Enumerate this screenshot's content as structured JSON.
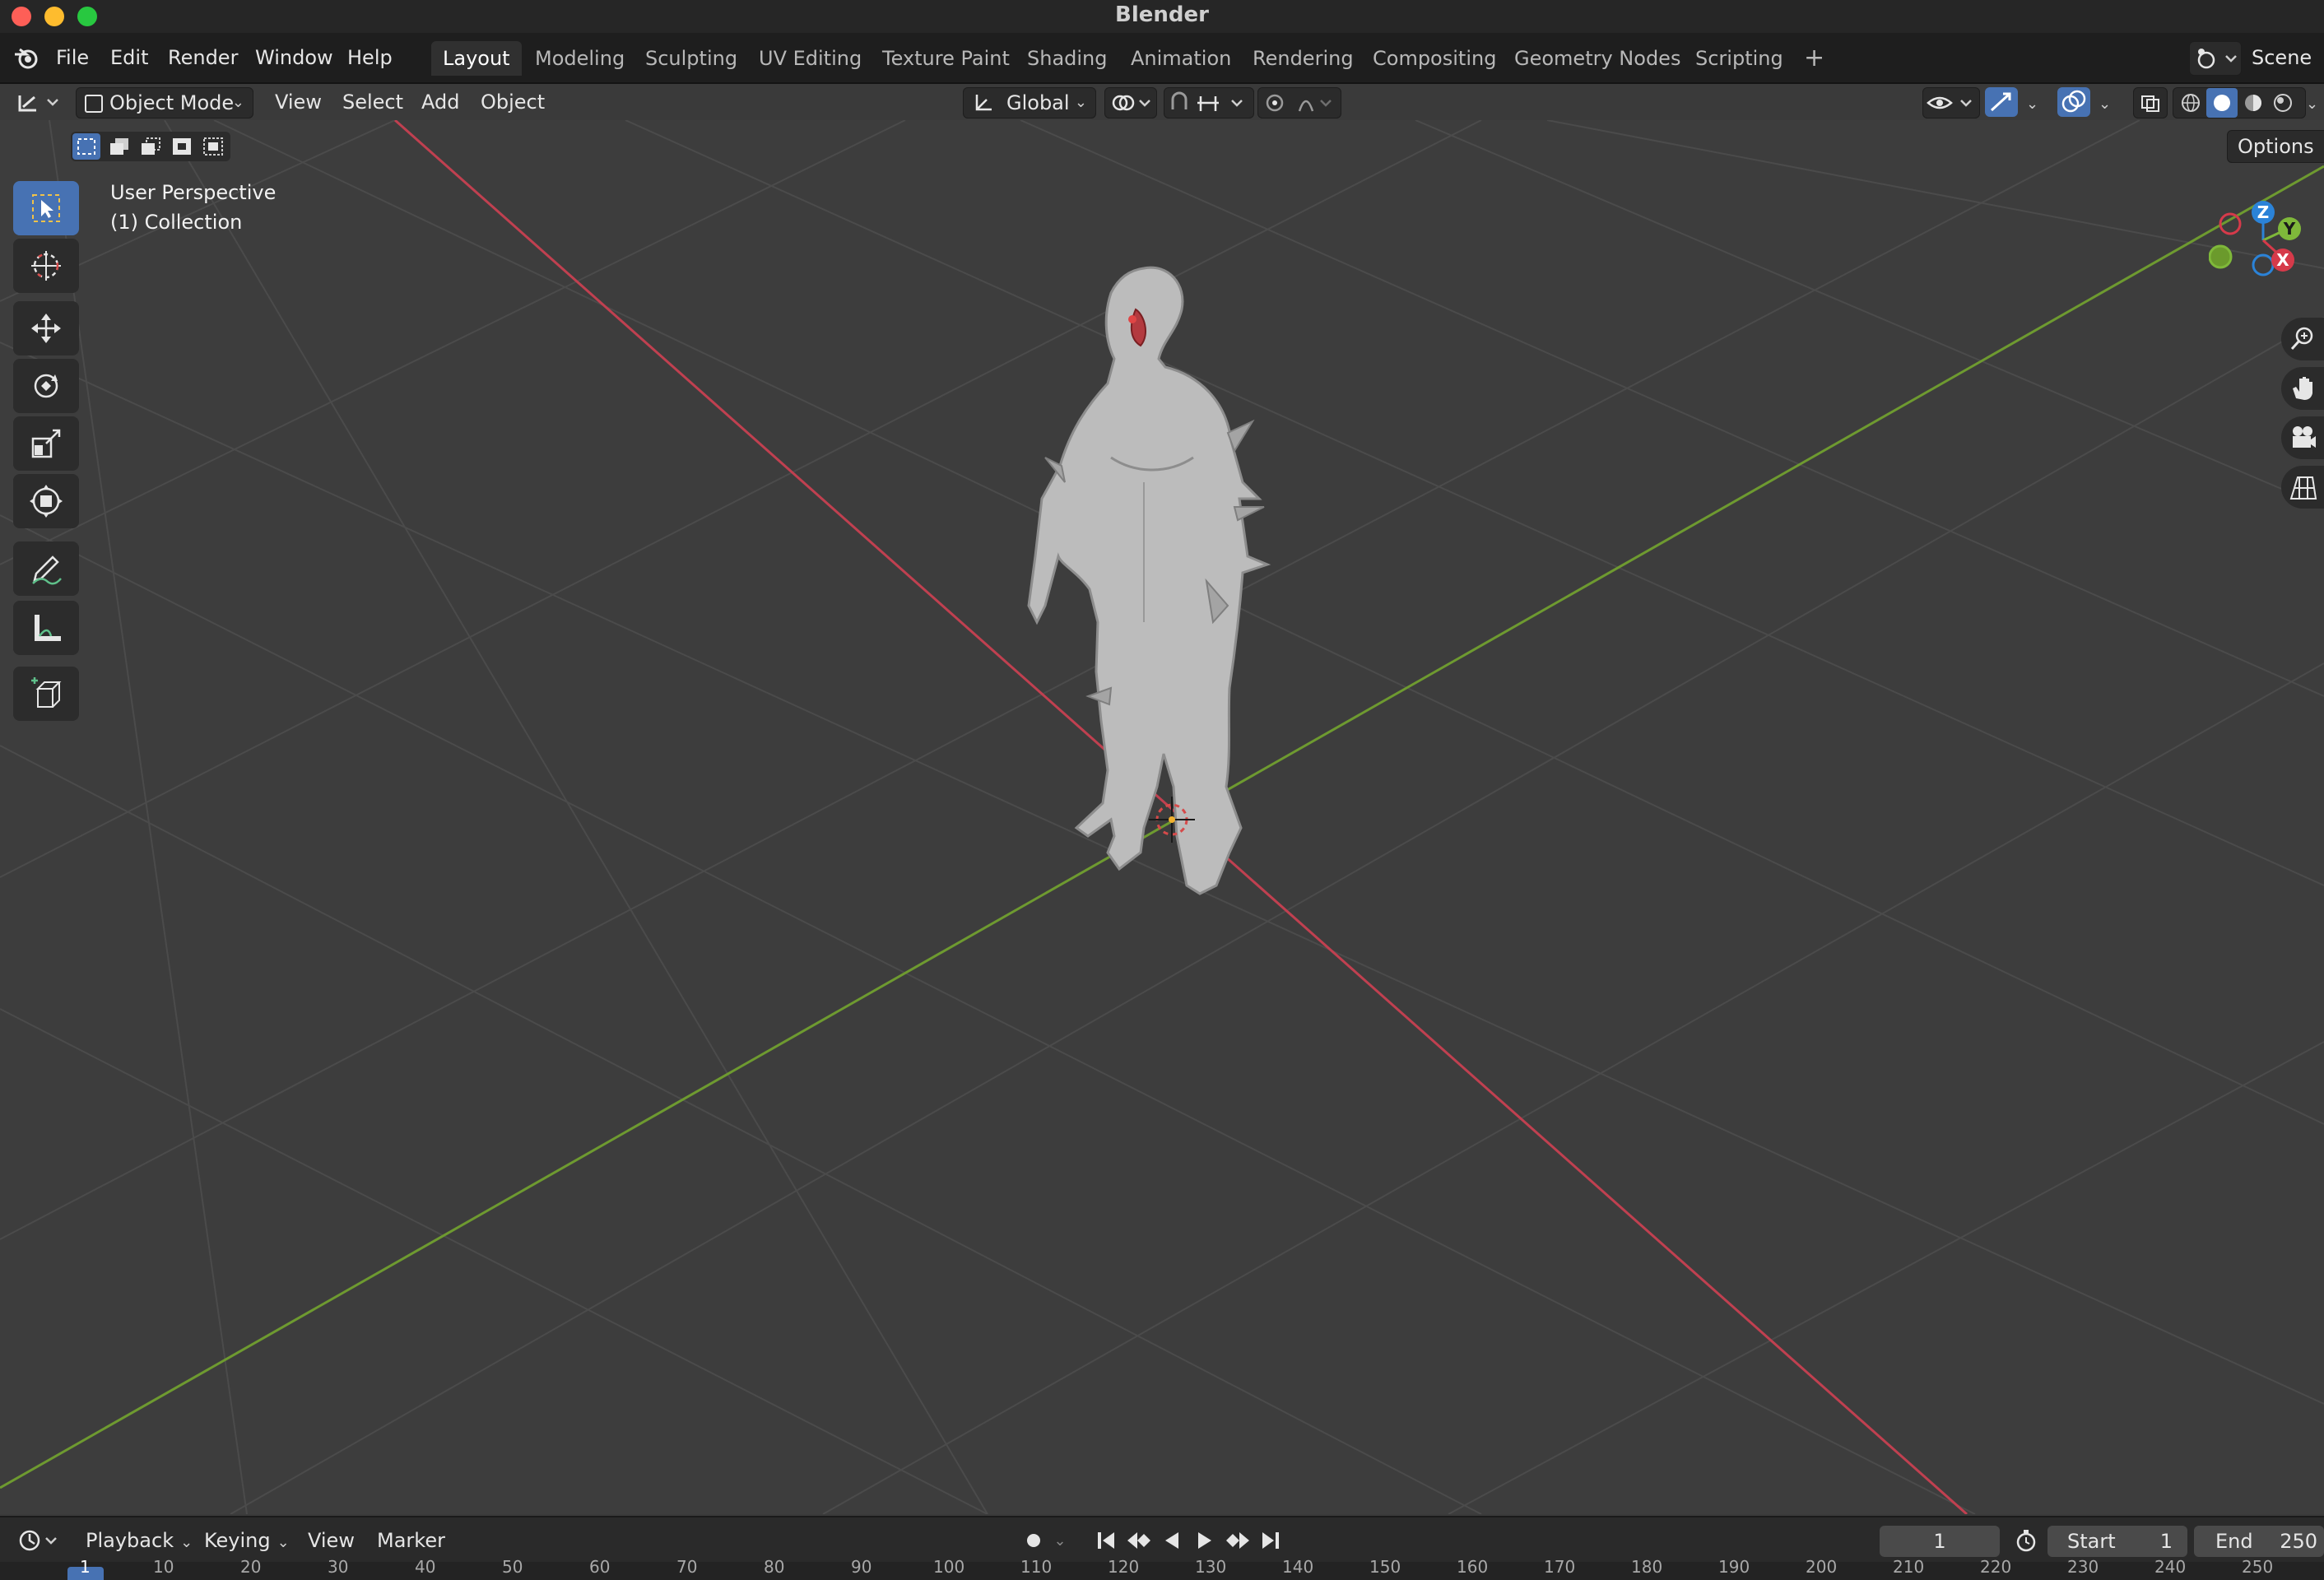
{
  "window": {
    "title": "Blender"
  },
  "menu": {
    "file": "File",
    "edit": "Edit",
    "render": "Render",
    "window": "Window",
    "help": "Help"
  },
  "workspaces": [
    "Layout",
    "Modeling",
    "Sculpting",
    "UV Editing",
    "Texture Paint",
    "Shading",
    "Animation",
    "Rendering",
    "Compositing",
    "Geometry Nodes",
    "Scripting"
  ],
  "scene": {
    "label": "Scene"
  },
  "viewport_header": {
    "mode": "Object Mode",
    "view": "View",
    "select": "Select",
    "add": "Add",
    "object": "Object",
    "orientation": "Global",
    "options": "Options"
  },
  "viewport": {
    "perspective": "User Perspective",
    "collection": "(1) Collection"
  },
  "gizmo": {
    "x": "X",
    "y": "Y",
    "z": "Z"
  },
  "timeline": {
    "playback": "Playback",
    "keying": "Keying",
    "view": "View",
    "marker": "Marker",
    "current_frame": "1",
    "start_label": "Start",
    "start_value": "1",
    "end_label": "End",
    "end_value": "250",
    "ruler": [
      "1",
      "10",
      "20",
      "30",
      "40",
      "50",
      "60",
      "70",
      "80",
      "90",
      "100",
      "110",
      "120",
      "130",
      "140",
      "150",
      "160",
      "170",
      "180",
      "190",
      "200",
      "210",
      "220",
      "230",
      "240",
      "250"
    ]
  },
  "colors": {
    "accent": "#4772b3",
    "x_axis": "#d63a4a",
    "y_axis": "#7fb83a",
    "z_axis": "#2b83d8"
  }
}
